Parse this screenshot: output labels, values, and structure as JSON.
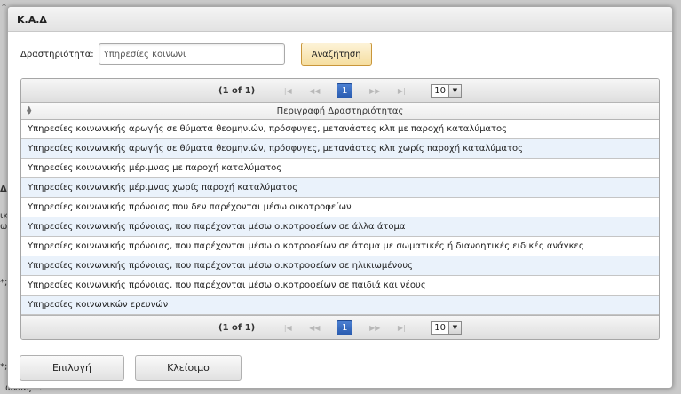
{
  "background": {
    "fragments": [
      "*",
      "Δ",
      "ικ",
      "ω",
      "τύ",
      "*;",
      "*;",
      "*;",
      "ωνίας *:"
    ]
  },
  "dialog": {
    "title": "Κ.Α.Δ",
    "search": {
      "label": "Δραστηριότητα:",
      "value": "Υπηρεσίες κοινωνι",
      "button": "Αναζήτηση"
    },
    "paginator": {
      "report": "(1 of 1)",
      "first_icon": "first-page-icon",
      "prev_icon": "prev-page-icon",
      "next_icon": "next-page-icon",
      "last_icon": "last-page-icon",
      "current_page": "1",
      "rows_per_page": "10"
    },
    "table": {
      "column_header": "Περιγραφή Δραστηριότητας",
      "rows": [
        "Υπηρεσίες κοινωνικής αρωγής σε θύματα θεομηνιών, πρόσφυγες, μετανάστες κλπ με παροχή καταλύματος",
        "Υπηρεσίες κοινωνικής αρωγής σε θύματα θεομηνιών, πρόσφυγες, μετανάστες κλπ χωρίς παροχή καταλύματος",
        "Υπηρεσίες κοινωνικής μέριμνας με παροχή καταλύματος",
        "Υπηρεσίες κοινωνικής μέριμνας χωρίς παροχή καταλύματος",
        "Υπηρεσίες κοινωνικής πρόνοιας που δεν παρέχονται μέσω οικοτροφείων",
        "Υπηρεσίες κοινωνικής πρόνοιας, που παρέχονται μέσω οικοτροφείων σε άλλα άτομα",
        "Υπηρεσίες κοινωνικής πρόνοιας, που παρέχονται μέσω οικοτροφείων σε άτομα με σωματικές ή διανοητικές ειδικές ανάγκες",
        "Υπηρεσίες κοινωνικής πρόνοιας, που παρέχονται μέσω οικοτροφείων σε ηλικιωμένους",
        "Υπηρεσίες κοινωνικής πρόνοιας, που παρέχονται μέσω οικοτροφείων σε παιδιά και νέους",
        "Υπηρεσίες κοινωνικών ερευνών"
      ]
    },
    "buttons": {
      "select": "Επιλογή",
      "close": "Κλείσιμο"
    }
  },
  "colors": {
    "row_alt": "#eaf2fb",
    "page_active": "#2a5cb0",
    "search_button": "#f5dea0"
  }
}
